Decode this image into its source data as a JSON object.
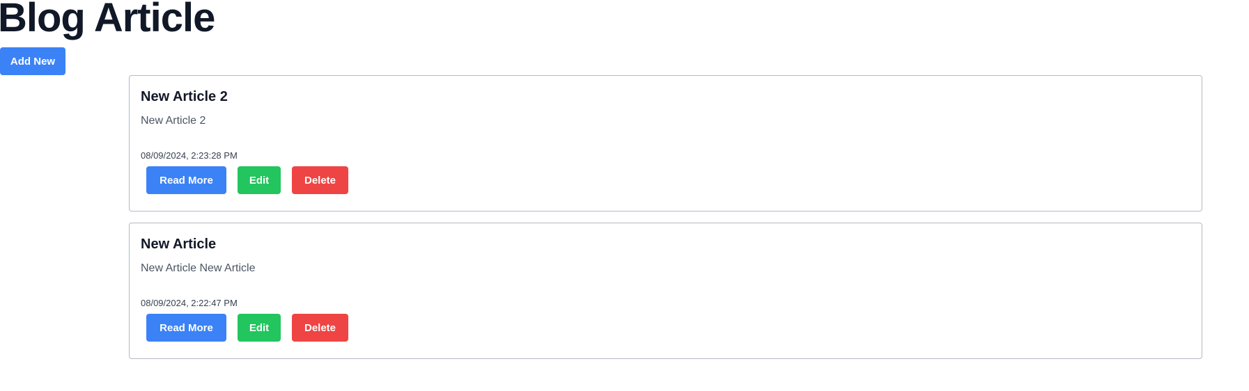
{
  "page": {
    "title": "Blog Article",
    "add_new_label": "Add New"
  },
  "articles": [
    {
      "title": "New Article 2",
      "excerpt": "New Article 2",
      "date": "08/09/2024, 2:23:28 PM",
      "read_more_label": "Read More",
      "edit_label": "Edit",
      "delete_label": "Delete"
    },
    {
      "title": "New Article",
      "excerpt": "New Article New Article",
      "date": "08/09/2024, 2:22:47 PM",
      "read_more_label": "Read More",
      "edit_label": "Edit",
      "delete_label": "Delete"
    }
  ],
  "colors": {
    "primary": "#3b82f6",
    "success": "#22c55e",
    "danger": "#ef4444",
    "heading": "#111827",
    "border": "#b5b9c0"
  }
}
